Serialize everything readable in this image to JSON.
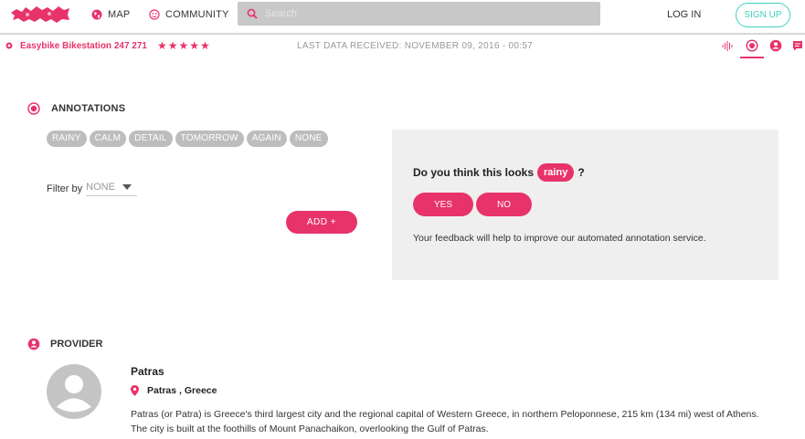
{
  "nav": {
    "map_label": "MAP",
    "community_label": "COMMUNITY",
    "search_placeholder": "Search",
    "login_label": "LOG IN",
    "signup_label": "SIGN UP"
  },
  "station": {
    "name": "Easybike Bikestation 247 271",
    "rating_stars": "★★★★★",
    "rating": 5,
    "last_data": "LAST DATA RECEIVED: NOVEMBER 09, 2016 - 00:57"
  },
  "annotations": {
    "heading": "ANNOTATIONS",
    "tags": [
      "RAINY",
      "CALM",
      "DETAIL",
      "TOMORROW",
      "AGAIN",
      "NONE"
    ],
    "filter_label": "Filter by",
    "filter_value": "NONE",
    "add_label": "ADD +"
  },
  "feedback": {
    "question": "Do you think this looks",
    "highlight": "rainy",
    "question_end": "?",
    "yes_label": "YES",
    "no_label": "NO",
    "note": "Your feedback will help to improve our automated annotation service."
  },
  "provider": {
    "heading": "PROVIDER",
    "name": "Patras",
    "location": "Patras , Greece",
    "description": "Patras (or Patra) is Greece's third largest city and the regional capital of Western Greece, in northern Peloponnese, 215 km (134 mi) west of Athens. The city is built at the foothills of Mount Panachaikon, overlooking the Gulf of Patras."
  },
  "colors": {
    "accent": "#e8336a",
    "signup": "#3fd0c0",
    "tag_bg": "#bdbdbd",
    "panel_bg": "#efefef"
  },
  "icons": [
    "logo-map",
    "globe-icon",
    "community-icon",
    "search-icon",
    "station-dot-icon",
    "waveform-icon",
    "target-icon",
    "person-icon",
    "comment-icon",
    "pin-icon",
    "avatar-icon"
  ]
}
